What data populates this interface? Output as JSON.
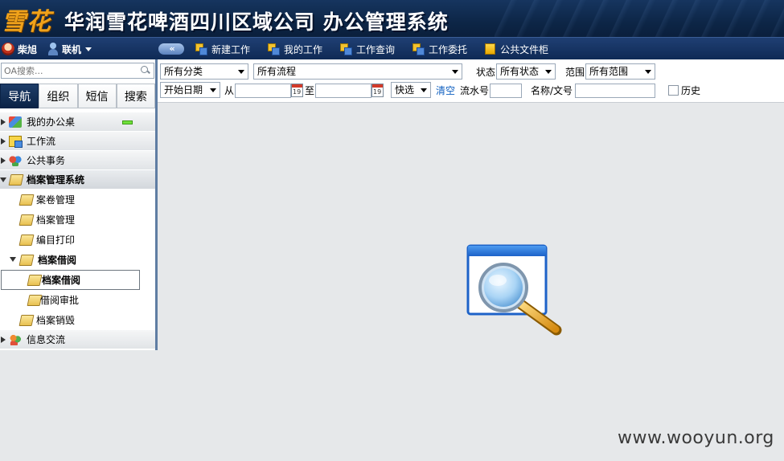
{
  "banner": {
    "logo": "雪花",
    "title": "华润雪花啤酒四川区域公司 办公管理系统"
  },
  "navbar": {
    "user_name": "柴旭",
    "status_label": "联机",
    "collapse_glyph": "«",
    "menu": [
      {
        "label": "新建工作",
        "icon": "workflow-icon"
      },
      {
        "label": "我的工作",
        "icon": "workflow-icon"
      },
      {
        "label": "工作查询",
        "icon": "workflow-icon"
      },
      {
        "label": "工作委托",
        "icon": "workflow-icon"
      },
      {
        "label": "公共文件柜",
        "icon": "folder-icon"
      }
    ]
  },
  "sidebar": {
    "search": {
      "placeholder": "OA搜索...",
      "value": ""
    },
    "tabs": [
      {
        "label": "导航",
        "active": true
      },
      {
        "label": "组织",
        "active": false
      },
      {
        "label": "短信",
        "active": false
      },
      {
        "label": "搜索",
        "active": false
      }
    ],
    "tree": {
      "my_desk": "我的办公桌",
      "workflow": "工作流",
      "public_affairs": "公共事务",
      "archive_system": "档案管理系统",
      "volume_mgmt": "案卷管理",
      "archive_mgmt": "档案管理",
      "catalog_print": "编目打印",
      "archive_borrow": "档案借阅",
      "archive_borrow_sub": "档案借阅",
      "borrow_approval": "借阅审批",
      "archive_destroy": "档案销毁",
      "info_exchange": "信息交流"
    }
  },
  "toolbar": {
    "category": "所有分类",
    "flow": "所有流程",
    "status_label": "状态",
    "status_value": "所有状态",
    "scope_label": "范围",
    "scope_value": "所有范围",
    "date_type": "开始日期",
    "from_label": "从",
    "to_label": "至",
    "quick_select": "快选",
    "clear_link": "清空",
    "serial_label": "流水号",
    "name_label": "名称/文号",
    "history_label": "历史"
  },
  "watermark": "www.wooyun.org",
  "colors": {
    "banner_bg": "#0d2647",
    "nav_bg": "#163363",
    "tab_active": "#0b2346",
    "main_bg": "#e6e8ea",
    "link": "#1060c0"
  }
}
